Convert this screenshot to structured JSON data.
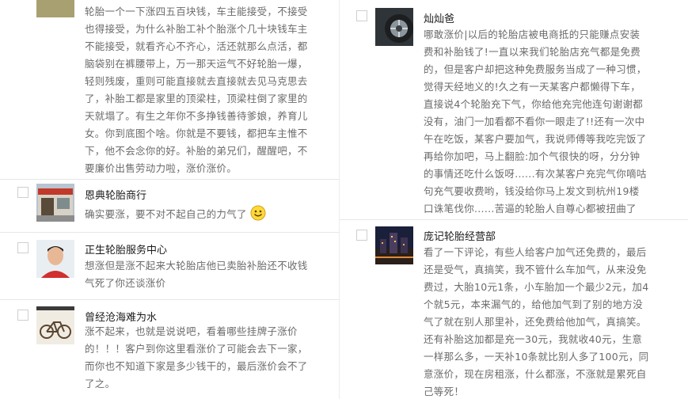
{
  "comments_left": [
    {
      "id": "c1",
      "name": "",
      "lines": [
        "轮胎一个一下涨四五百块钱，车主能接受，不接受",
        "也得接受，为什么补胎工补个胎涨个几十块钱车主",
        "不能接受，就看齐心不齐心，活还就那么点活，都",
        "脑袋别在裤腰带上，万一那天运气不好轮胎一爆，",
        "轻则残废，重则可能直接就去直接就去见马克思去",
        "了，补胎工都是家里的顶梁柱，顶梁柱倒了家里的",
        "天就塌了。有生之年你不多挣钱善待爹娘，养育儿",
        "女。你到底图个啥。你就是不要钱，都把车主惟不",
        "下，他不会念你的好。补胎的弟兄们，醒醒吧，不",
        "要廉价出售劳动力啦，涨价涨价。"
      ]
    },
    {
      "id": "c2",
      "name": "恩典轮胎商行",
      "lines": [
        "确实要涨，要不对不起自己的力气了"
      ]
    },
    {
      "id": "c3",
      "name": "正生轮胎服务中心",
      "lines": [
        "想涨但是涨不起来大轮胎店他已卖胎补胎还不收钱",
        "气死了你还谈涨价"
      ]
    },
    {
      "id": "c4",
      "name": "曾经沧海难为水",
      "lines": [
        "涨不起来，也就是说说吧，看着哪些挂牌子涨价",
        "的！！！客户到你这里看涨价了可能会去下一家，",
        "而你也不知道下家是多少钱干的，最后涨价会不了",
        "了之。"
      ]
    }
  ],
  "comments_right": [
    {
      "id": "c5",
      "name": "灿灿爸",
      "lines": [
        "哪敢涨价|以后的轮胎店被电商抵的只能赚点安装",
        "费和补胎钱了!一直以来我们轮胎店充气都是免费",
        "的，但是客户却把这种免费服务当成了一种习惯，",
        "觉得天经地义的!久之有一天某客户都懒得下车，",
        "直接说4个轮胎充下气，你给他充完他连句谢谢都",
        "没有，油门一加看都不看你一眼走了!!还有一次中",
        "午在吃饭，某客户要加气，我说师傅等我吃完饭了",
        "再给你加吧，马上翻脸:加个气很快的呀，分分钟",
        "的事情还吃什么饭呀......有次某客户充完气你嘀咕",
        "句充气要收费哟，钱没给你马上发文到杭州19楼",
        "口诛笔伐你......苦逼的轮胎人自尊心都被扭曲了"
      ]
    },
    {
      "id": "c6",
      "name": "庞记轮胎经营部",
      "lines": [
        "看了一下评论，有些人给客户加气还免费的，最后",
        "还是受气，真搞笑，我不管什么车加气，从来没免",
        "费过，大胎10元1条，小车胎加一个最少2元，加4",
        "个就5元，本来漏气的，给他加气到了别的地方没",
        "气了就在别人那里补，还免费给他加气，真搞笑。",
        "还有补胎这加都是充一30元，我就收40元，生意",
        "一样那么多，一天补10条就比别人多了100元，同",
        "意涨价，现在房租涨，什么都涨，不涨就是累死自",
        "己等死！"
      ]
    }
  ],
  "icons": {
    "c1": "partial-photo-avatar",
    "c2": "shop-photo-avatar",
    "c3": "man-photo-avatar",
    "c4": "bicycle-photo-avatar",
    "c5": "tire-photo-avatar",
    "c6": "night-city-avatar",
    "emoji": "smile-emoji-icon"
  },
  "colors": {
    "name_text": "#1a1a1a",
    "comment_text": "#6b6b6b",
    "divider": "#e7e7e7",
    "emoji_face": "#ffd93b"
  }
}
